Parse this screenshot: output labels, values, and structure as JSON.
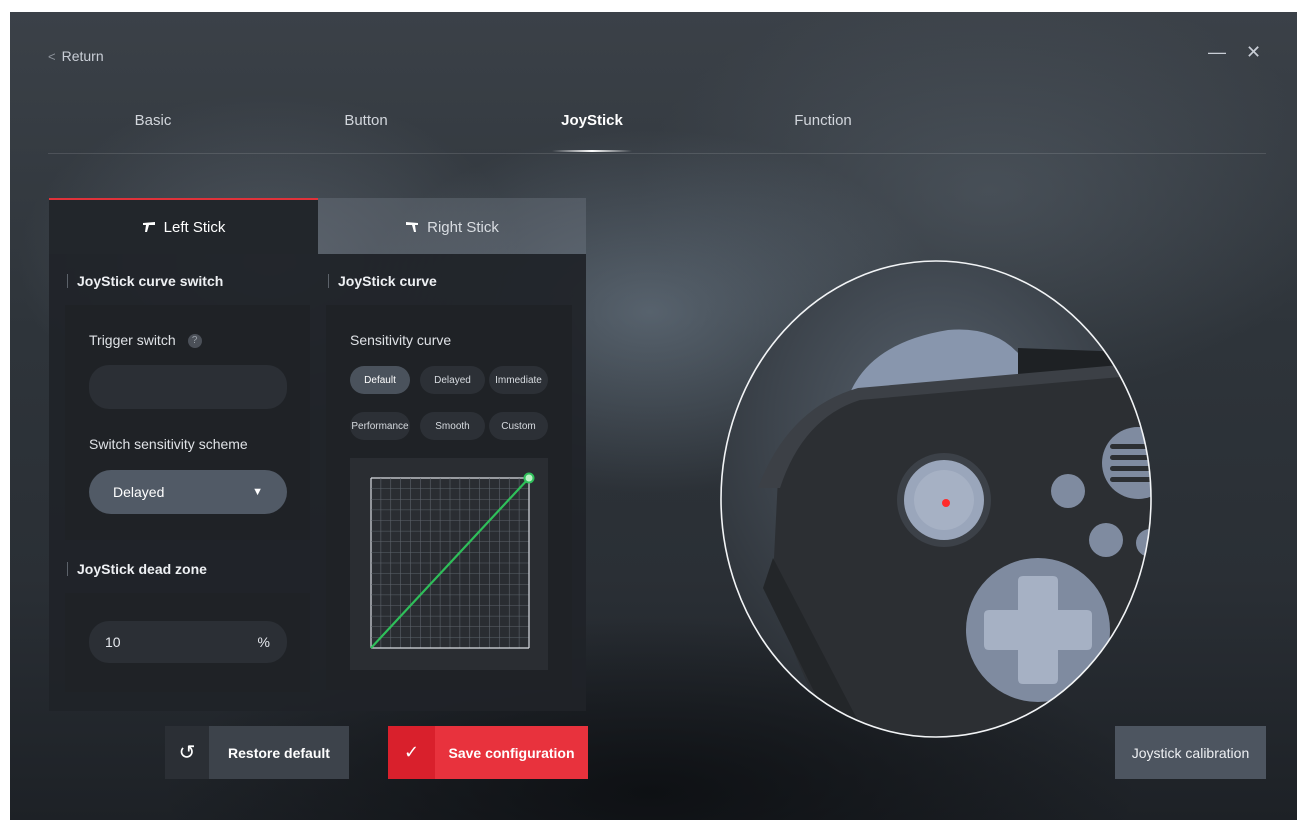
{
  "header": {
    "return_label": "Return",
    "minimize_glyph": "—",
    "close_glyph": "✕"
  },
  "tabs": [
    {
      "label": "Basic",
      "active": false
    },
    {
      "label": "Button",
      "active": false
    },
    {
      "label": "JoyStick",
      "active": true
    },
    {
      "label": "Function",
      "active": false
    }
  ],
  "sticks": {
    "left": {
      "label": "Left Stick",
      "active": true
    },
    "right": {
      "label": "Right Stick",
      "active": false
    }
  },
  "curve_switch": {
    "title": "JoyStick curve switch",
    "trigger_label": "Trigger switch",
    "help_glyph": "?",
    "trigger_value": "",
    "scheme_label": "Switch sensitivity scheme",
    "scheme_value": "Delayed"
  },
  "dead_zone": {
    "title": "JoyStick dead zone",
    "value": "10",
    "unit": "%"
  },
  "joystick_curve": {
    "title": "JoyStick curve",
    "sensitivity_label": "Sensitivity curve",
    "options": [
      "Default",
      "Delayed",
      "Immediate",
      "Performance",
      "Smooth",
      "Custom"
    ],
    "selected": "Default",
    "curve_color": "#2fbf5a"
  },
  "buttons": {
    "restore": "Restore default",
    "save": "Save configuration",
    "calibration": "Joystick calibration"
  },
  "colors": {
    "accent_red": "#e8323d",
    "panel_bg": "#22262b",
    "stick_cap": "#8b9bb8",
    "dot": "#ff2a2a"
  }
}
